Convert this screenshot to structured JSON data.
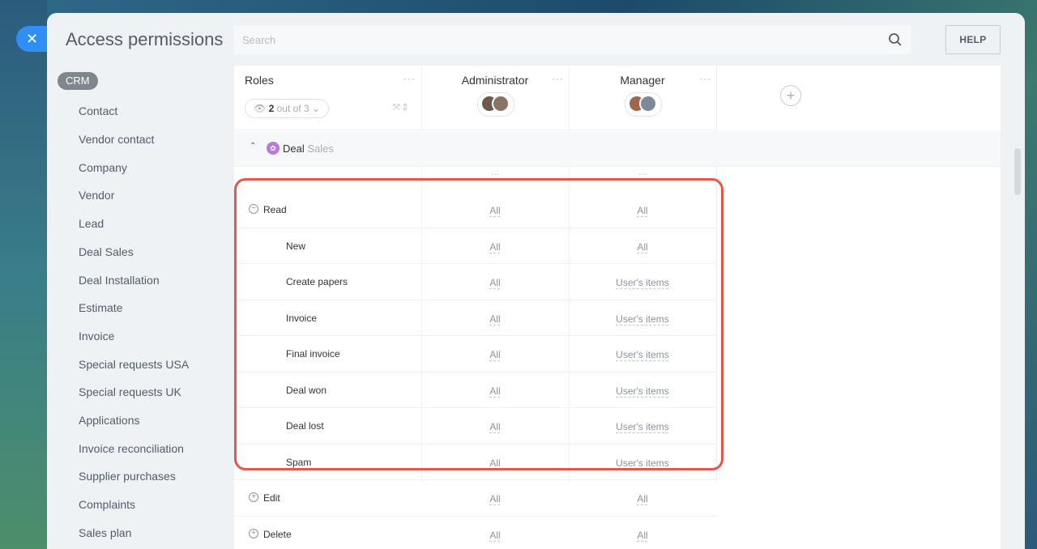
{
  "window": {
    "title": "Access permissions",
    "close_label": "✕"
  },
  "search": {
    "placeholder": "Search",
    "icon": "search-icon"
  },
  "help_label": "HELP",
  "sidebar": {
    "active_badge": "CRM",
    "items": [
      "Contact",
      "Vendor contact",
      "Company",
      "Vendor",
      "Lead",
      "Deal Sales",
      "Deal Installation",
      "Estimate",
      "Invoice",
      "Special requests USA",
      "Special requests UK",
      "Applications",
      "Invoice reconciliation",
      "Supplier purchases",
      "Complaints",
      "Sales plan"
    ]
  },
  "table": {
    "roles_label": "Roles",
    "menu_dots": "···",
    "filter": {
      "count": "2",
      "text": " out of 3"
    },
    "columns": [
      {
        "title": "Administrator"
      },
      {
        "title": "Manager"
      }
    ],
    "add_column_label": "+",
    "section": {
      "title": "Deal",
      "subtitle": "Sales"
    },
    "rows": [
      {
        "label": "Read",
        "kind": "top",
        "toggle": "−",
        "admin": "All",
        "manager": "All"
      },
      {
        "label": "New",
        "kind": "sub",
        "admin": "All",
        "manager": "All"
      },
      {
        "label": "Create papers",
        "kind": "sub",
        "admin": "All",
        "manager": "User's items"
      },
      {
        "label": "Invoice",
        "kind": "sub",
        "admin": "All",
        "manager": "User's items"
      },
      {
        "label": "Final invoice",
        "kind": "sub",
        "admin": "All",
        "manager": "User's items"
      },
      {
        "label": "Deal won",
        "kind": "sub",
        "admin": "All",
        "manager": "User's items"
      },
      {
        "label": "Deal lost",
        "kind": "sub",
        "admin": "All",
        "manager": "User's items"
      },
      {
        "label": "Spam",
        "kind": "sub",
        "admin": "All",
        "manager": "User's items"
      },
      {
        "label": "Edit",
        "kind": "top",
        "toggle": "+",
        "admin": "All",
        "manager": "All"
      },
      {
        "label": "Delete",
        "kind": "top",
        "toggle": "+",
        "admin": "All",
        "manager": "All"
      }
    ]
  },
  "colors": {
    "accent": "#2f8ff5",
    "highlight": "#e8564a"
  }
}
